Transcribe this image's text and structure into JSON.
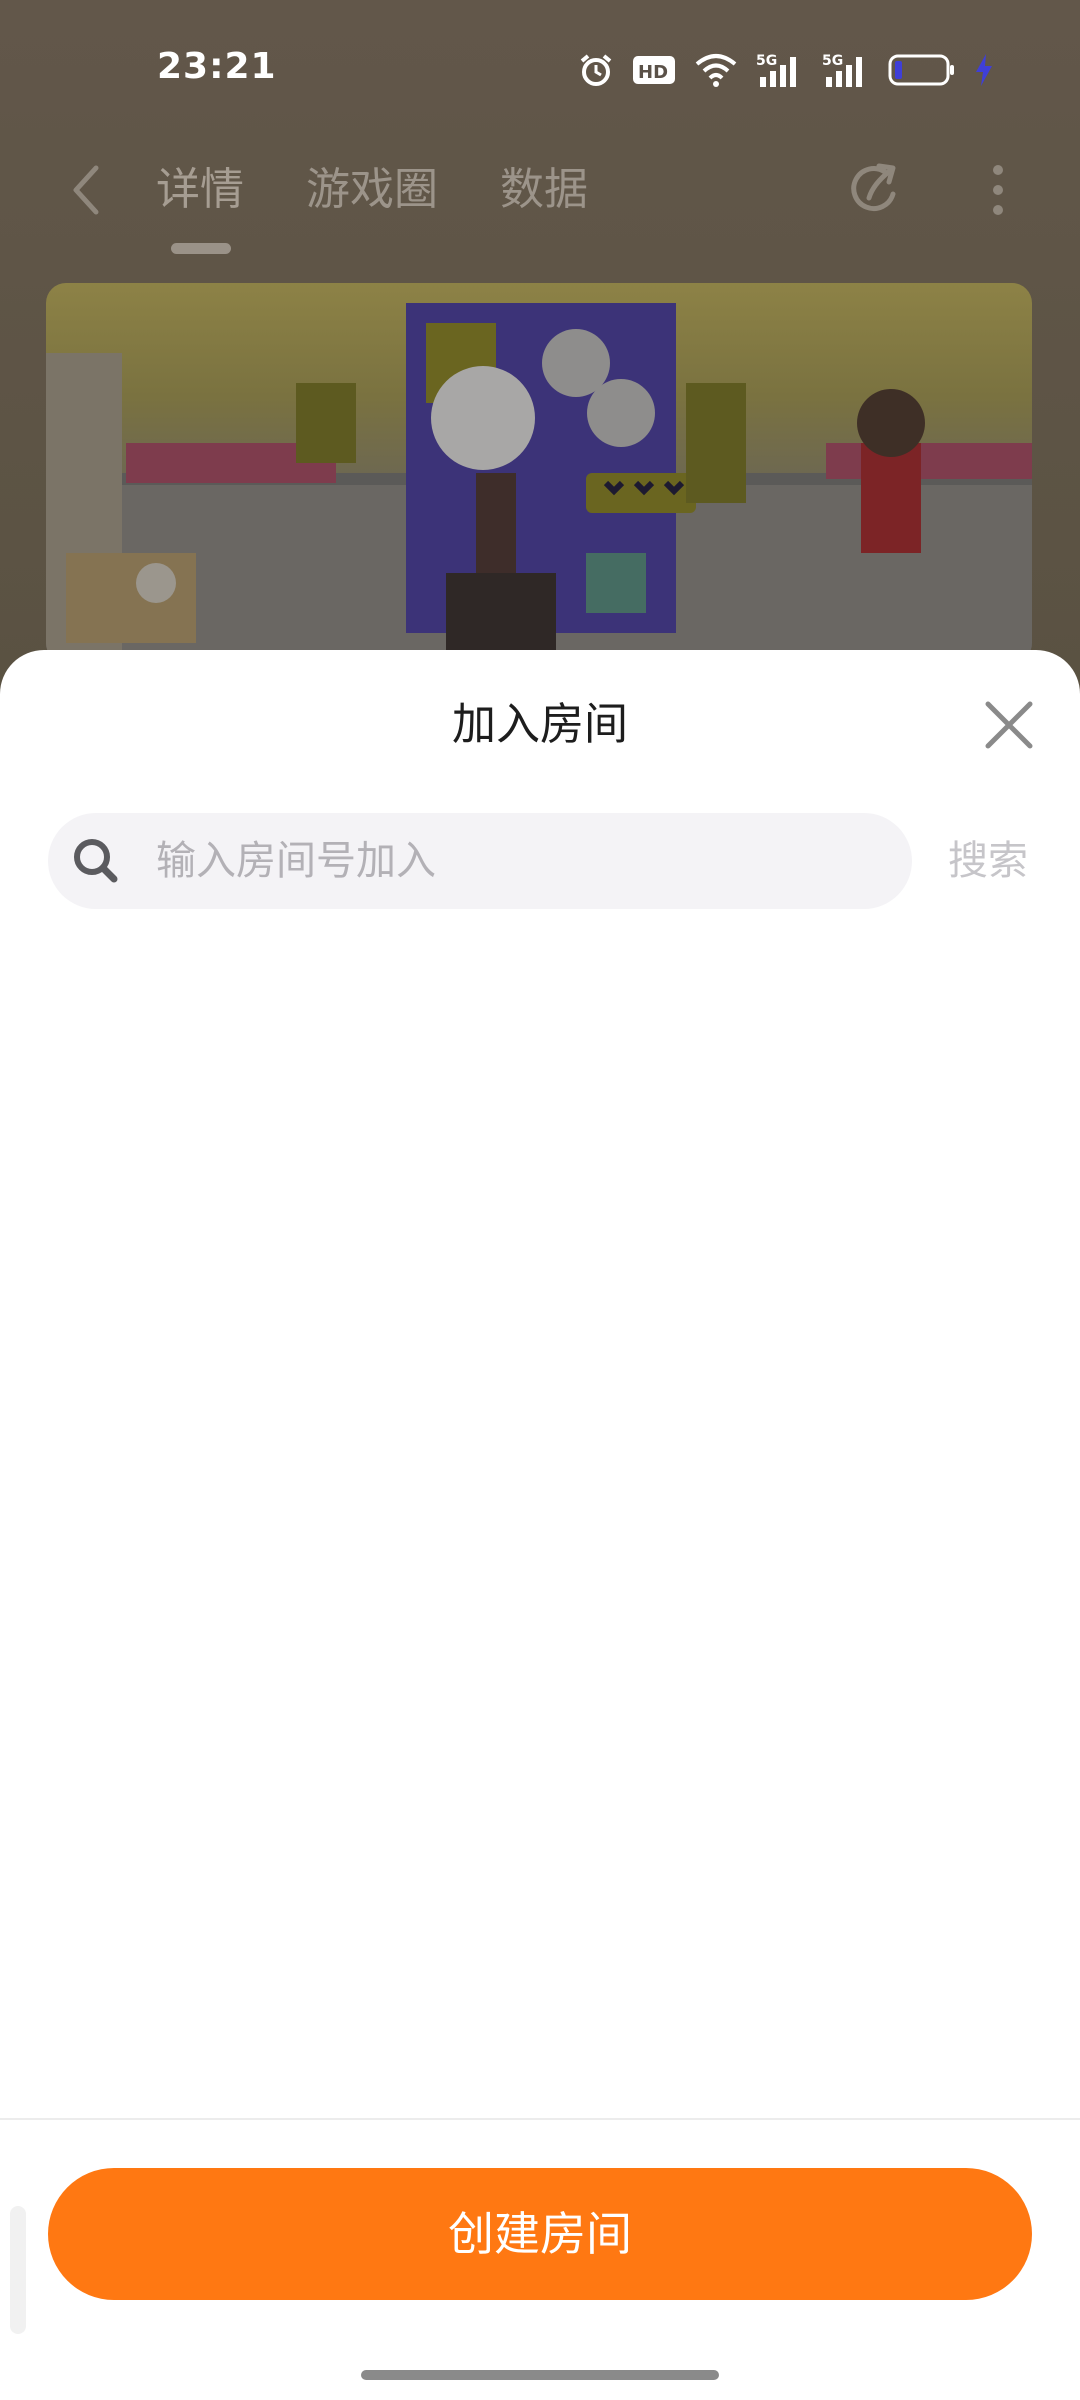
{
  "status_bar": {
    "time": "23:21",
    "network_label": "5G",
    "icons": [
      "alarm-icon",
      "hd-icon",
      "wifi-icon",
      "signal-5g-icon",
      "signal-5g-icon",
      "battery-icon",
      "charging-icon"
    ]
  },
  "nav": {
    "tabs": [
      {
        "label": "详情",
        "active": true
      },
      {
        "label": "游戏圈",
        "active": false
      },
      {
        "label": "数据",
        "active": false
      }
    ],
    "icons": [
      "back-icon",
      "share-icon",
      "more-icon"
    ]
  },
  "sheet": {
    "title": "加入房间",
    "search_placeholder": "输入房间号加入",
    "search_value": "",
    "search_button": "搜索",
    "create_button": "创建房间"
  },
  "colors": {
    "accent": "#ff7812",
    "sheet_background": "#ffffff",
    "search_background": "#f4f3f6",
    "placeholder": "#b3b1b6"
  }
}
